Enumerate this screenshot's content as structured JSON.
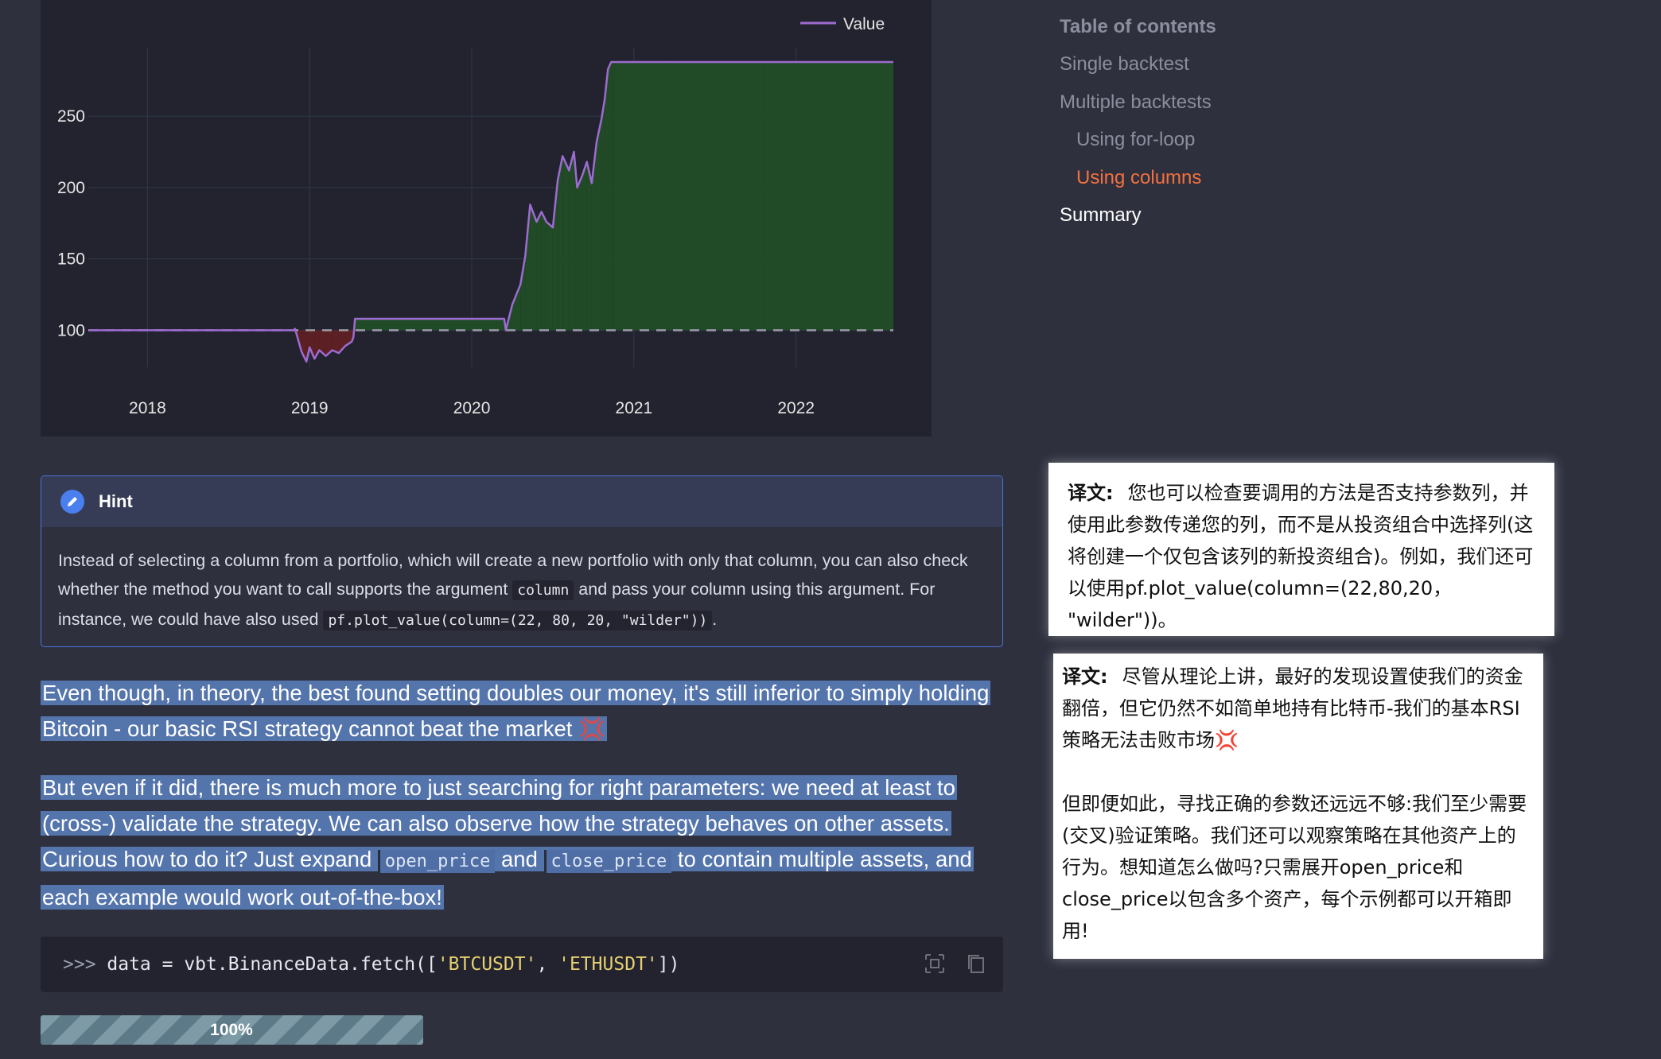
{
  "chart": {
    "legend": "Value",
    "colors": {
      "line": "#9d6bd1",
      "profit_fill": "#214a26",
      "loss_fill": "#5c1f23",
      "baseline": "#9a9aa6",
      "grid": "#2f3a4a"
    }
  },
  "chart_data": {
    "type": "line",
    "title": "",
    "xlabel": "",
    "ylabel": "",
    "x_ticks": [
      "2018",
      "2019",
      "2020",
      "2021",
      "2022"
    ],
    "y_ticks": [
      "100",
      "150",
      "200",
      "250"
    ],
    "ylim": [
      74,
      298
    ],
    "xlim": [
      2017.635,
      2022.6
    ],
    "baseline": 100,
    "grid": true,
    "legend_position": "top-right",
    "series": [
      {
        "name": "Value",
        "x": [
          2017.64,
          2018.5,
          2018.9,
          2018.91,
          2018.95,
          2018.98,
          2019.0,
          2019.03,
          2019.06,
          2019.1,
          2019.14,
          2019.18,
          2019.22,
          2019.26,
          2019.27,
          2019.28,
          2019.6,
          2020.0,
          2020.2,
          2020.21,
          2020.25,
          2020.3,
          2020.33,
          2020.36,
          2020.4,
          2020.43,
          2020.46,
          2020.5,
          2020.53,
          2020.56,
          2020.6,
          2020.63,
          2020.65,
          2020.68,
          2020.71,
          2020.74,
          2020.77,
          2020.8,
          2020.82,
          2020.84,
          2020.86,
          2020.87,
          2020.88,
          2021.2,
          2021.8,
          2022.6
        ],
        "values": [
          100,
          100,
          100,
          101,
          85,
          78,
          88,
          80,
          86,
          82,
          86,
          84,
          89,
          92,
          95,
          108,
          108,
          108,
          108,
          100,
          118,
          132,
          152,
          188,
          176,
          183,
          176,
          172,
          205,
          222,
          212,
          225,
          200,
          208,
          218,
          203,
          232,
          248,
          262,
          283,
          288,
          288,
          288,
          288,
          288,
          288
        ]
      }
    ]
  },
  "toc": {
    "title": "Table of contents",
    "items": [
      "Single backtest",
      "Multiple backtests",
      "Using for-loop",
      "Using columns",
      "Summary"
    ]
  },
  "hint": {
    "title": "Hint",
    "text1": "Instead of selecting a column from a portfolio, which will create a new portfolio with only that column, you can also check whether the method you want to call supports the argument ",
    "code1": "column",
    "text2": " and pass your column using this argument. For instance, we could have also used ",
    "code2": "pf.plot_value(column=(22, 80, 20, \"wilder\"))",
    "text3": "."
  },
  "para1": {
    "text": "Even though, in theory, the best found setting doubles our money, it's still inferior to simply holding Bitcoin - our basic RSI strategy cannot beat the market ",
    "emoji": "💢"
  },
  "para2": {
    "text1": "But even if it did, there is much more to just searching for right parameters: we need at least to (cross-) validate the strategy. We can also observe how the strategy behaves on other assets. Curious how to do it? Just expand ",
    "code1": "open_price",
    "text2": " and ",
    "code2": "close_price",
    "text3": " to contain multiple assets, and each example would work out-of-the-box!"
  },
  "code": {
    "prompt": ">>> ",
    "pre": "data = vbt.BinanceData.fetch([",
    "str1": "'BTCUSDT'",
    "sep": ", ",
    "str2": "'ETHUSDT'",
    "post": "])"
  },
  "progress": {
    "label": "100%",
    "value": 1.0
  },
  "translation1": {
    "prefix": "译文:",
    "text": "您也可以检查要调用的方法是否支持参数列，并使用此参数传递您的列，而不是从投资组合中选择列(这将创建一个仅包含该列的新投资组合)。例如，我们还可以使用pf.plot_value(column=(22,80,20， \"wilder\"))。"
  },
  "translation2": {
    "prefix": "译文:",
    "text1": "尽管从理论上讲，最好的发现设置使我们的资金翻倍，但它仍然不如简单地持有比特币-我们的基本RSI策略无法击败市场",
    "emoji": "💢",
    "text2": "但即便如此，寻找正确的参数还远远不够:我们至少需要(交叉)验证策略。我们还可以观察策略在其他资产上的行为。想知道怎么做吗?只需展开open_price和close_price以包含多个资产，每个示例都可以开箱即用!"
  }
}
